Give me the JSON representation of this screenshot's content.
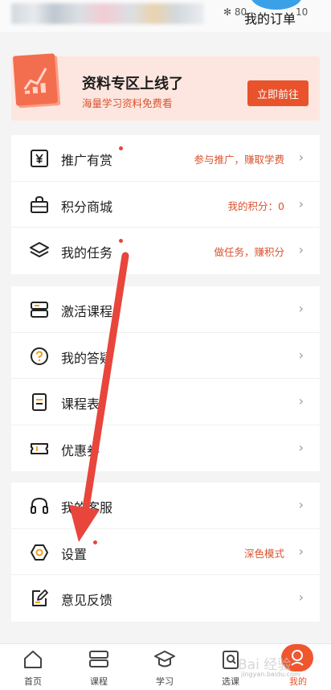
{
  "status_bar": {
    "indicators": "✻ 80",
    "tail": "10"
  },
  "header": {
    "orders_label": "我的订单"
  },
  "banner": {
    "title": "资料专区上线了",
    "subtitle": "海量学习资料免费看",
    "button_label": "立即前往",
    "accent": "#e8532c"
  },
  "menu_groups": [
    {
      "items": [
        {
          "icon": "yuan-coupon-icon",
          "label": "推广有赏",
          "value": "参与推广，赚取学费",
          "dot": true
        },
        {
          "icon": "shopping-bag-icon",
          "label": "积分商城",
          "value": "我的积分：0",
          "dot": false
        },
        {
          "icon": "layers-icon",
          "label": "我的任务",
          "value": "做任务，赚积分",
          "dot": true
        }
      ]
    },
    {
      "items": [
        {
          "icon": "ticket-activate-icon",
          "label": "激活课程",
          "value": "",
          "dot": false
        },
        {
          "icon": "question-bubble-icon",
          "label": "我的答疑",
          "value": "",
          "dot": false
        },
        {
          "icon": "document-list-icon",
          "label": "课程表",
          "value": "",
          "dot": false
        },
        {
          "icon": "coupon-icon",
          "label": "优惠券",
          "value": "",
          "dot": false
        }
      ]
    },
    {
      "items": [
        {
          "icon": "headset-icon",
          "label": "我的客服",
          "value": "",
          "dot": false
        },
        {
          "icon": "gear-hexagon-icon",
          "label": "设置",
          "value": "深色模式",
          "dot": true
        },
        {
          "icon": "feedback-edit-icon",
          "label": "意见反馈",
          "value": "",
          "dot": false
        }
      ]
    }
  ],
  "bottom_nav": [
    {
      "icon": "home-icon",
      "label": "首页",
      "active": false
    },
    {
      "icon": "course-icon",
      "label": "课程",
      "active": false
    },
    {
      "icon": "graduation-cap-icon",
      "label": "学习",
      "active": false
    },
    {
      "icon": "clipboard-icon",
      "label": "选课",
      "active": false
    },
    {
      "icon": "profile-icon",
      "label": "我的",
      "active": true
    }
  ],
  "watermark": {
    "text": "Bai 经验",
    "url": "jingyan.baidu.com"
  },
  "colors": {
    "accent": "#e8532c",
    "dot": "#e8453c",
    "annotation_arrow": "#e8453c"
  }
}
